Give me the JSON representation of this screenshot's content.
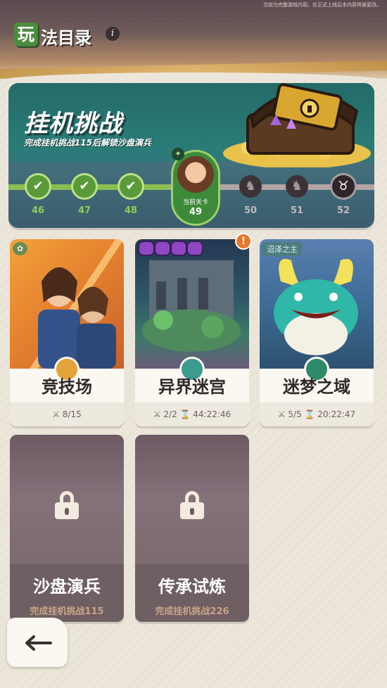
{
  "header": {
    "notice": "当前为完整游戏内容。在正式上线后本内容将被更改。",
    "title_first": "玩",
    "title_rest": "法目录",
    "info_icon": "i"
  },
  "idle_challenge": {
    "name": "挂机挑战",
    "subtitle": "完成挂机挑战115后解锁沙盘演兵",
    "levels": [
      {
        "label": "46",
        "state": "done"
      },
      {
        "label": "47",
        "state": "done"
      },
      {
        "label": "48",
        "state": "done"
      },
      {
        "label": "50",
        "state": "locked"
      },
      {
        "label": "51",
        "state": "locked"
      },
      {
        "label": "52",
        "state": "boss"
      }
    ],
    "current": {
      "label": "当前关卡",
      "number": "49"
    }
  },
  "cards": [
    {
      "name": "竞技场",
      "stats": "⚔ 8/15"
    },
    {
      "name": "异界迷宫",
      "stats": "⚔ 2/2   ⌛ 44:22:46"
    },
    {
      "name": "迷梦之域",
      "stats": "⚔ 5/5   ⌛ 20:22:47",
      "tag": "沼泽之主"
    },
    {
      "name": "沙盘演兵",
      "requirement": "完成挂机挑战115"
    },
    {
      "name": "传承试炼",
      "requirement": "完成挂机挑战226"
    }
  ],
  "alert": "!",
  "colors": {
    "accent_green": "#5a9a3a",
    "card_bg": "#fbf8f1",
    "locked": "#78686b",
    "alert": "#e8792b"
  }
}
